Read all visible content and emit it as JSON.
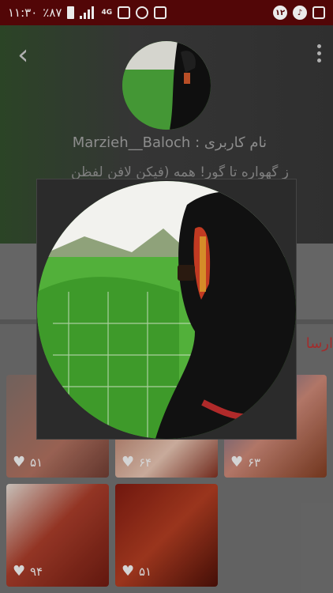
{
  "status_bar": {
    "time": "۱۱:۳۰",
    "battery": "٪۸۷",
    "network": "4G",
    "notification_count": "۱۲"
  },
  "profile": {
    "username_label": "نام کاربری : Marzieh__Baloch",
    "bio": "ز گهواره تا گور! همه (فیکن لافن لفظن"
  },
  "tabs": {
    "sent_label": "ارسا"
  },
  "posts": [
    {
      "likes": "۵۱"
    },
    {
      "likes": "۶۴"
    },
    {
      "likes": "۶۳"
    },
    {
      "likes": "۹۴"
    },
    {
      "likes": "۵۱"
    }
  ],
  "colors": {
    "status_bar": "#5a0708",
    "accent": "#b03030"
  }
}
